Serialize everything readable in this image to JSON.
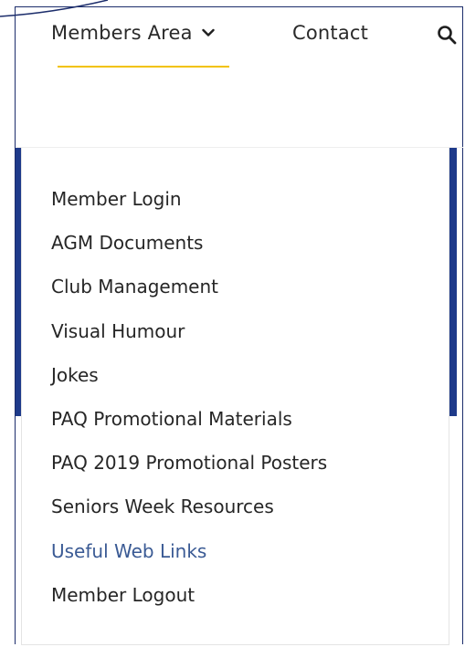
{
  "nav": {
    "members_area_label": "Members Area",
    "contact_label": "Contact",
    "search_icon": "search-icon",
    "chevron_icon": "chevron-down-icon"
  },
  "dropdown": {
    "items": [
      {
        "label": "Member Login"
      },
      {
        "label": "AGM Documents"
      },
      {
        "label": "Club Management"
      },
      {
        "label": "Visual Humour"
      },
      {
        "label": "Jokes"
      },
      {
        "label": "PAQ Promotional Materials"
      },
      {
        "label": "PAQ 2019 Promotional Posters"
      },
      {
        "label": "Seniors Week Resources"
      },
      {
        "label": "Useful Web Links",
        "active": true
      },
      {
        "label": "Member Logout"
      }
    ]
  },
  "colors": {
    "accent_underline": "#f2c200",
    "side_bar": "#1e3a8a",
    "active_link": "#3a5a94",
    "text": "#262626",
    "border": "#1c2d6b"
  }
}
